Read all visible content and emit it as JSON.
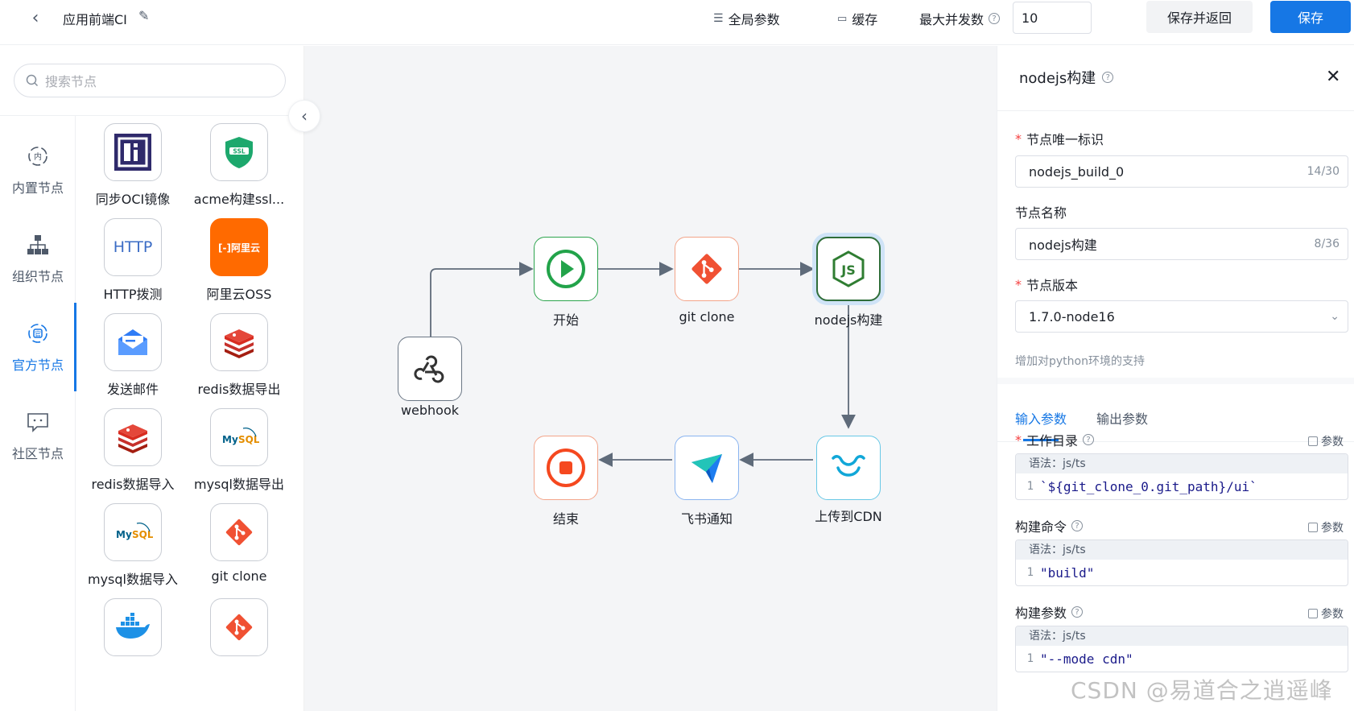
{
  "topbar": {
    "title": "应用前端CI",
    "global_params": "全局参数",
    "cache": "缓存",
    "max_concurrency_label": "最大并发数",
    "max_concurrency_value": "10",
    "save_return": "保存并返回",
    "save": "保存"
  },
  "left": {
    "search_placeholder": "搜索节点",
    "categories": [
      {
        "label": "内置节点",
        "icon": "builtin-icon"
      },
      {
        "label": "组织节点",
        "icon": "org-icon"
      },
      {
        "label": "官方节点",
        "icon": "official-icon",
        "active": true
      },
      {
        "label": "社区节点",
        "icon": "community-icon"
      }
    ],
    "nodes": [
      {
        "label": "同步OCI镜像",
        "icon": "oci-icon"
      },
      {
        "label": "acme构建ssl...",
        "icon": "ssl-icon"
      },
      {
        "label": "HTTP拨测",
        "icon": "http-icon",
        "icon_text": "HTTP"
      },
      {
        "label": "阿里云OSS",
        "icon": "aliyun-icon",
        "icon_text": "[-]阿里云"
      },
      {
        "label": "发送邮件",
        "icon": "mail-icon"
      },
      {
        "label": "redis数据导出",
        "icon": "redis-icon"
      },
      {
        "label": "redis数据导入",
        "icon": "redis-icon"
      },
      {
        "label": "mysql数据导出",
        "icon": "mysql-icon"
      },
      {
        "label": "mysql数据导入",
        "icon": "mysql-icon"
      },
      {
        "label": "git clone",
        "icon": "git-icon"
      },
      {
        "label": "",
        "icon": "docker-icon"
      },
      {
        "label": "",
        "icon": "git-icon"
      }
    ]
  },
  "canvas": {
    "nodes": [
      {
        "id": "webhook",
        "label": "webhook",
        "icon": "webhook-icon"
      },
      {
        "id": "start",
        "label": "开始",
        "icon": "play-icon"
      },
      {
        "id": "gitclone",
        "label": "git clone",
        "icon": "git-icon"
      },
      {
        "id": "nodejs",
        "label": "nodejs构建",
        "icon": "nodejs-icon",
        "selected": true
      },
      {
        "id": "cdn",
        "label": "上传到CDN",
        "icon": "cdn-icon"
      },
      {
        "id": "feishu",
        "label": "飞书通知",
        "icon": "feishu-icon"
      },
      {
        "id": "end",
        "label": "结束",
        "icon": "stop-icon"
      }
    ]
  },
  "panel": {
    "title": "nodejs构建",
    "node_id_label": "节点唯一标识",
    "node_id_value": "nodejs_build_0",
    "node_id_count": "14/30",
    "node_name_label": "节点名称",
    "node_name_value": "nodejs构建",
    "node_name_count": "8/36",
    "version_label": "节点版本",
    "version_value": "1.7.0-node16",
    "version_hint": "增加对python环境的支持",
    "tabs": [
      "输入参数",
      "输出参数"
    ],
    "param_btn": "参数",
    "fields": [
      {
        "label": "工作目录",
        "required": true,
        "syntax": "语法：js/ts",
        "line": "1",
        "code": "`${git_clone_0.git_path}/ui`"
      },
      {
        "label": "构建命令",
        "required": false,
        "syntax": "语法：js/ts",
        "line": "1",
        "code": "\"build\""
      },
      {
        "label": "构建参数",
        "required": false,
        "syntax": "语法：js/ts",
        "line": "1",
        "code": "\"--mode cdn\""
      }
    ]
  },
  "watermark": "CSDN @易道合之逍遥峰"
}
